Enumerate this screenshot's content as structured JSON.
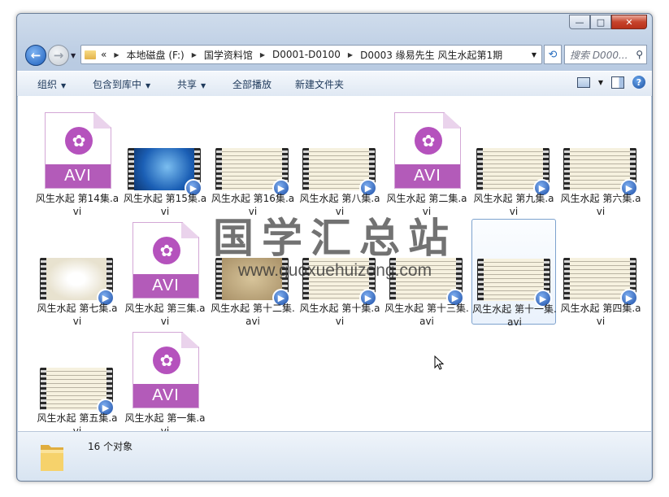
{
  "window": {
    "controls": {
      "minimize": "—",
      "maximize": "□",
      "close": "✕"
    }
  },
  "nav": {
    "back_glyph": "←",
    "forward_glyph": "→",
    "breadcrumb": [
      "本地磁盘 (F:)",
      "国学资料馆",
      "D0001-D0100",
      "D0003 缘易先生 风生水起第1期"
    ],
    "overflow": "«",
    "search_placeholder": "搜索 D000..."
  },
  "toolbar": {
    "organize": "组织",
    "include_in_library": "包含到库中",
    "share": "共享",
    "play_all": "全部播放",
    "new_folder": "新建文件夹"
  },
  "files": [
    {
      "name": "风生水起 第14集.avi",
      "icon": "avi-document-icon"
    },
    {
      "name": "风生水起 第15集.avi",
      "icon": "desktop-thumb"
    },
    {
      "name": "风生水起 第16集.avi",
      "icon": "text-thumb"
    },
    {
      "name": "风生水起 第八集.avi",
      "icon": "text-thumb"
    },
    {
      "name": "风生水起 第二集.avi",
      "icon": "avi-document-icon"
    },
    {
      "name": "风生水起 第九集.avi",
      "icon": "text-thumb"
    },
    {
      "name": "风生水起 第六集.avi",
      "icon": "text-thumb"
    },
    {
      "name": "风生水起 第七集.avi",
      "icon": "chart-thumb"
    },
    {
      "name": "风生水起 第三集.avi",
      "icon": "avi-document-icon"
    },
    {
      "name": "风生水起 第十二集.avi",
      "icon": "paper-thumb"
    },
    {
      "name": "风生水起 第十集.avi",
      "icon": "text-thumb"
    },
    {
      "name": "风生水起 第十三集.avi",
      "icon": "text-thumb"
    },
    {
      "name": "风生水起 第十一集.avi",
      "icon": "text-thumb",
      "selected": true
    },
    {
      "name": "风生水起 第四集.avi",
      "icon": "text-thumb"
    },
    {
      "name": "风生水起 第五集.avi",
      "icon": "text-thumb"
    },
    {
      "name": "风生水起 第一集.avi",
      "icon": "avi-document-icon"
    }
  ],
  "avi_label": "AVI",
  "watermark": {
    "title": "国学汇总站",
    "url": "www.guoxuehuizong.com"
  },
  "status": {
    "count_text": "16 个对象"
  }
}
